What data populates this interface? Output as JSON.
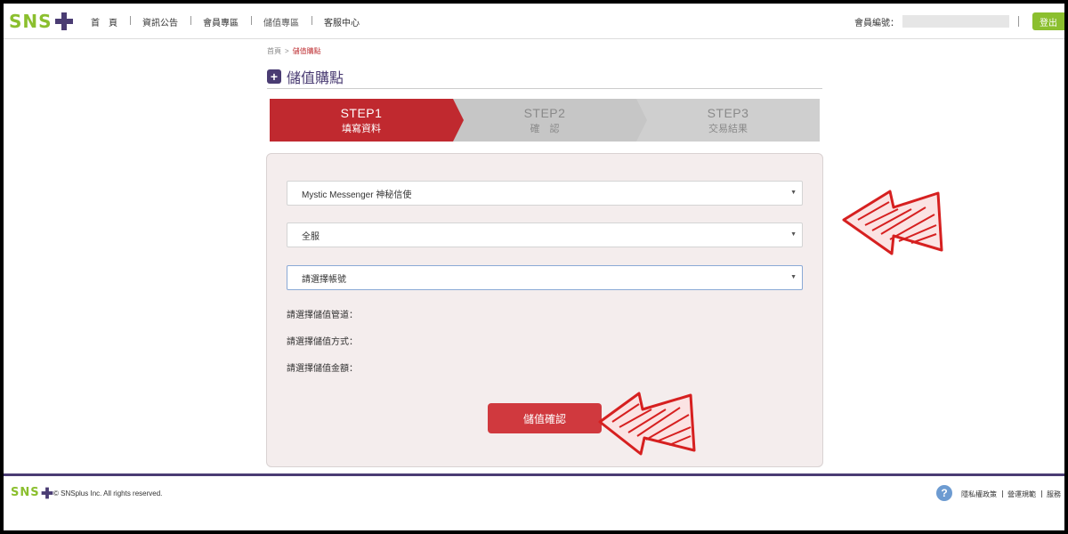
{
  "header": {
    "logo": "SNS",
    "nav": [
      "首　頁",
      "資訊公告",
      "會員專區",
      "儲值專區",
      "客服中心"
    ],
    "member_label": "會員編號：",
    "logout": "登出"
  },
  "breadcrumb": {
    "home": "首頁",
    "sep": ">",
    "current": "儲值購點"
  },
  "page_title": "儲值購點",
  "steps": [
    {
      "title": "STEP1",
      "sub": "填寫資料"
    },
    {
      "title": "STEP2",
      "sub": "確　認"
    },
    {
      "title": "STEP3",
      "sub": "交易結果"
    }
  ],
  "form": {
    "game_select": "Mystic Messenger 神秘信使",
    "server_select": "全服",
    "account_select": "請選擇帳號",
    "channel_label": "請選擇儲值管道：",
    "method_label": "請選擇儲值方式：",
    "amount_label": "請選擇儲值金額：",
    "confirm_button": "儲值確認"
  },
  "footer": {
    "logo": "SNS",
    "copyright": "© SNSplus Inc. All rights reserved.",
    "help_icon_glyph": "?",
    "links": [
      "隱私權政策",
      "營運規範",
      "服務"
    ]
  },
  "colors": {
    "brand_green": "#8bbf2e",
    "brand_purple": "#4a3c73",
    "accent_red": "#c0292f"
  }
}
